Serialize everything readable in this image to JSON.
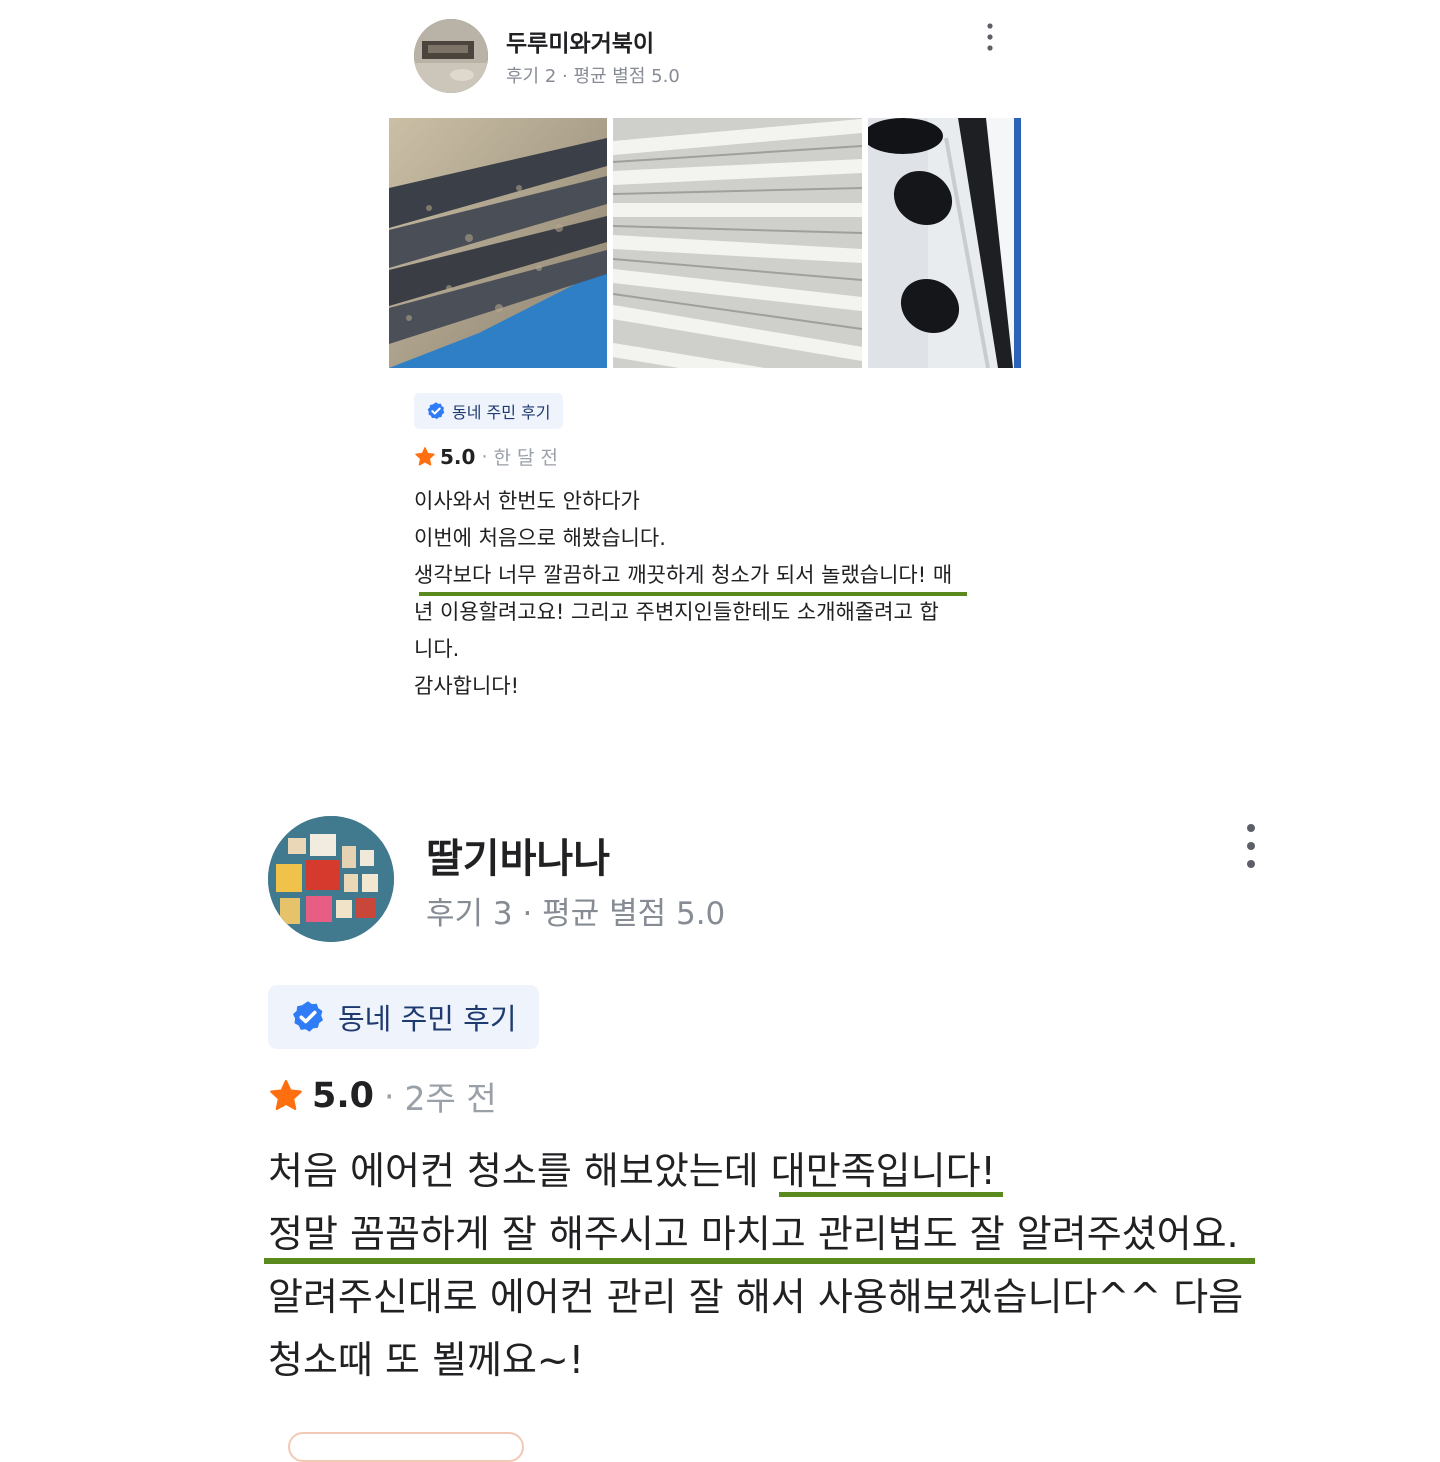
{
  "reviews": [
    {
      "user_name": "두루미와거북이",
      "user_meta": "후기 2 · 평균 별점 5.0",
      "badge": "동네 주민 후기",
      "rating": "5.0",
      "separator": "·",
      "time_ago": "한 달 전",
      "body_lines": [
        "이사와서 한번도 안하다가",
        "이번에 처음으로 해봤습니다.",
        "생각보다 너무 깔끔하고 깨끗하게 청소가 되서 놀랬습니다! 매",
        "년 이용할려고요! 그리고 주변지인들한테도 소개해줄려고 합",
        "니다.",
        "감사합니다!"
      ],
      "photos": [
        "air-conditioner-louver-dirty",
        "air-conditioner-grille-cleaned",
        "air-conditioner-vanes"
      ]
    },
    {
      "user_name": "딸기바나나",
      "user_meta": "후기 3 · 평균 별점 5.0",
      "badge": "동네 주민 후기",
      "rating": "5.0",
      "separator": "·",
      "time_ago": "2주 전",
      "body_lines": [
        "처음 에어컨 청소를 해보았는데 대만족입니다!",
        "정말 꼼꼼하게 잘 해주시고 마치고 관리법도 잘 알려주셨어요.",
        "알려주신대로 에어컨 관리 잘 해서 사용해보겠습니다^^ 다음",
        "청소때 또 뵐께요~!"
      ]
    }
  ],
  "colors": {
    "star": "#ff6f0f",
    "verified": "#2f7cf6",
    "badge_bg": "#eef3fc",
    "highlight_underline": "#5a8a1e",
    "meta_text": "#868b94"
  },
  "icons": {
    "more": "more-vertical-icon",
    "star": "star-icon",
    "verified": "verified-check-icon"
  }
}
